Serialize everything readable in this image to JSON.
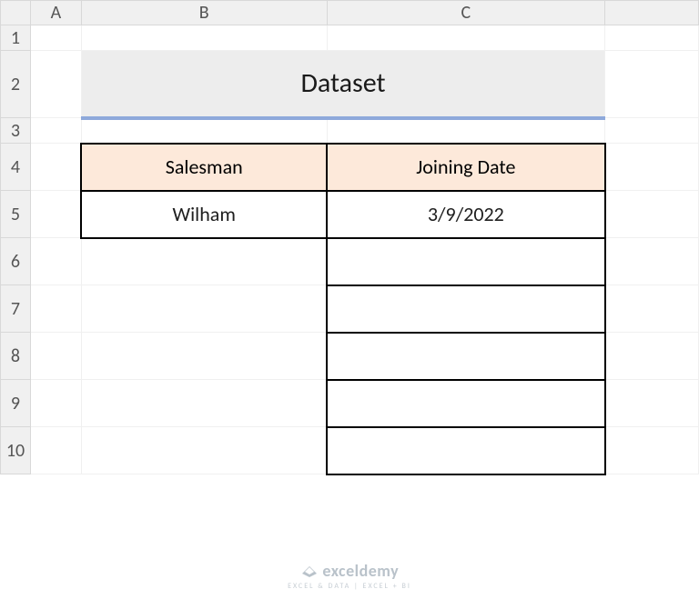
{
  "columns": {
    "A": "A",
    "B": "B",
    "C": "C"
  },
  "rows": {
    "r1": "1",
    "r2": "2",
    "r3": "3",
    "r4": "4",
    "r5": "5",
    "r6": "6",
    "r7": "7",
    "r8": "8",
    "r9": "9",
    "r10": "10"
  },
  "title": "Dataset",
  "table": {
    "headers": {
      "salesman": "Salesman",
      "joining_date": "Joining Date"
    },
    "rows": [
      {
        "salesman": "Wilham",
        "joining_date": "3/9/2022"
      }
    ]
  },
  "watermark": {
    "brand": "exceldemy",
    "sub": "EXCEL & DATA | EXCEL + BI"
  },
  "colors": {
    "title_underline": "#8ea9db",
    "header_fill": "#fde9da",
    "title_fill": "#ededed"
  },
  "chart_data": {
    "type": "table",
    "title": "Dataset",
    "columns": [
      "Salesman",
      "Joining Date"
    ],
    "rows": [
      [
        "Wilham",
        "3/9/2022"
      ],
      [
        "",
        ""
      ],
      [
        "",
        ""
      ],
      [
        "",
        ""
      ],
      [
        "",
        ""
      ],
      [
        "",
        ""
      ]
    ]
  }
}
